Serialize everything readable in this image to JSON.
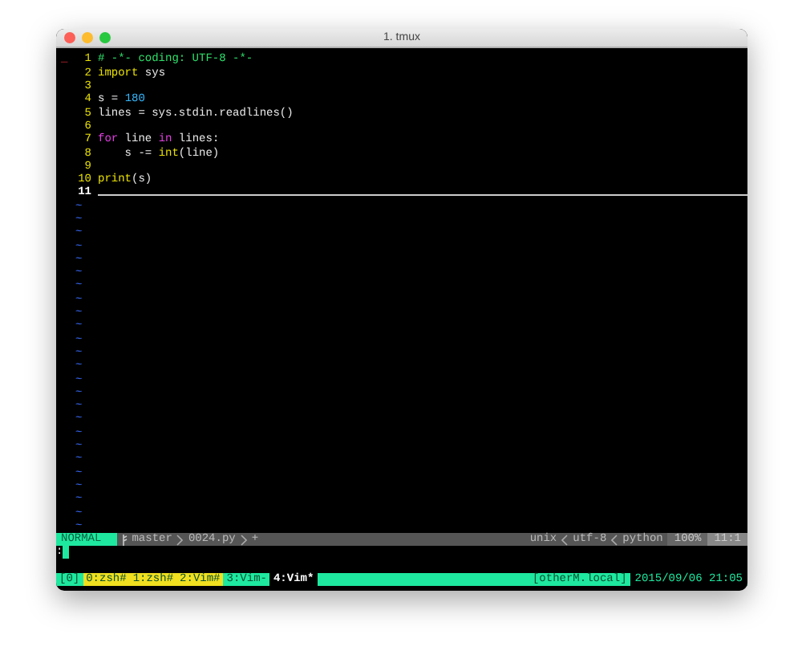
{
  "window": {
    "title": "1. tmux"
  },
  "editor": {
    "lines": [
      {
        "number": "1",
        "sign": "_",
        "current": false,
        "tokens": [
          {
            "kind": "comment",
            "text": "# -*- coding: UTF-8 -*-"
          }
        ]
      },
      {
        "number": "2",
        "current": false,
        "tokens": [
          {
            "kind": "keyword",
            "text": "import"
          },
          {
            "kind": "plain",
            "text": " sys"
          }
        ]
      },
      {
        "number": "3",
        "current": false
      },
      {
        "number": "4",
        "current": false,
        "tokens": [
          {
            "kind": "plain",
            "text": "s = "
          },
          {
            "kind": "number",
            "text": "180"
          }
        ]
      },
      {
        "number": "5",
        "current": false,
        "tokens": [
          {
            "kind": "plain",
            "text": "lines = sys.stdin.readlines()"
          }
        ]
      },
      {
        "number": "6",
        "current": false
      },
      {
        "number": "7",
        "current": false,
        "tokens": [
          {
            "kind": "control",
            "text": "for"
          },
          {
            "kind": "plain",
            "text": " line "
          },
          {
            "kind": "control",
            "text": "in"
          },
          {
            "kind": "plain",
            "text": " lines:"
          }
        ]
      },
      {
        "number": "8",
        "current": false,
        "tokens": [
          {
            "kind": "plain",
            "text": "    s -= "
          },
          {
            "kind": "builtin",
            "text": "int"
          },
          {
            "kind": "plain",
            "text": "(line)"
          }
        ]
      },
      {
        "number": "9",
        "current": false
      },
      {
        "number": "10",
        "current": false,
        "tokens": [
          {
            "kind": "builtin",
            "text": "print"
          },
          {
            "kind": "plain",
            "text": "(s)"
          }
        ]
      },
      {
        "number": "11",
        "current": true
      }
    ],
    "tildes": [
      "~",
      "~",
      "~",
      "~",
      "~",
      "~",
      "~",
      "~",
      "~",
      "~",
      "~",
      "~",
      "~",
      "~",
      "~",
      "~",
      "~",
      "~",
      "~",
      "~",
      "~",
      "~",
      "~",
      "~",
      "~"
    ]
  },
  "statusline": {
    "mode": "NORMAL",
    "branch": "master",
    "file": "0024.py",
    "modified": "+",
    "format": "unix",
    "encoding": "utf-8",
    "filetype": "python",
    "percent": "100%",
    "position": "11:1"
  },
  "command_line": {
    "text": ":"
  },
  "tmux": {
    "session": "[0]",
    "windows": [
      {
        "label": "0:zsh#",
        "activity": true,
        "selected": false
      },
      {
        "label": "1:zsh#",
        "activity": true,
        "selected": false
      },
      {
        "label": "2:Vim#",
        "activity": true,
        "selected": false
      },
      {
        "label": "3:Vim-",
        "activity": false,
        "selected": false
      },
      {
        "label": "4:Vim*",
        "activity": false,
        "selected": true
      }
    ],
    "host": "[otherM.local]",
    "datetime": "2015/09/06 21:05"
  }
}
